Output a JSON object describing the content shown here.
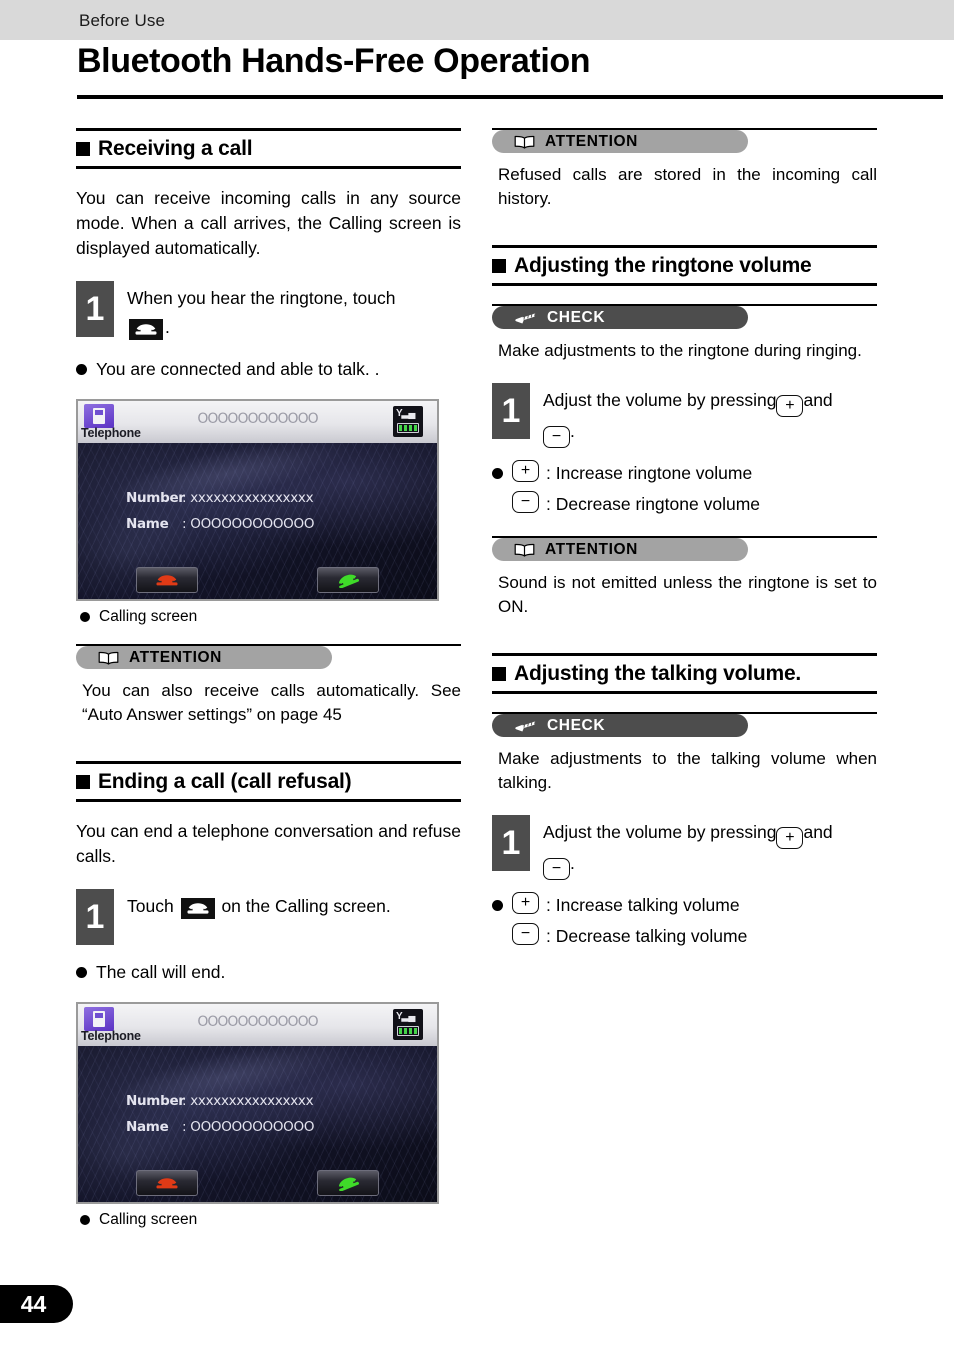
{
  "header": {
    "breadcrumb": "Before Use",
    "title": "Bluetooth Hands-Free Operation"
  },
  "footer": {
    "page_number": "44"
  },
  "icons": {
    "phone_handset": "phone-handset-icon",
    "book": "open-book-icon",
    "pencil": "pencil-icon",
    "plus_key": "plus-key-icon",
    "minus_key": "minus-key-icon"
  },
  "colors": {
    "header_band": "#d9d9d9",
    "step_badge": "#4d4d4d",
    "attention_pill": "#a3a3a3",
    "check_pill": "#4d4d4d",
    "page_pill": "#000000"
  },
  "keys": {
    "plus": "+",
    "minus": "−"
  },
  "left_column": {
    "section_receiving": {
      "heading": "Receiving a call",
      "intro": "You can receive incoming calls in any source mode. When a call arrives, the Calling screen is displayed automatically.",
      "step": {
        "number": "1",
        "text_before": "When you hear the ringtone, touch",
        "text_after": "."
      },
      "result_bullet": "You are connected and able to talk. .",
      "screen_caption": "Calling screen"
    },
    "attention_autoanswer": {
      "label": "ATTENTION",
      "body": "You can also receive calls automatically. See “Auto Answer settings” on page 45"
    },
    "section_ending": {
      "heading": "Ending a call (call refusal)",
      "intro": "You can end a telephone conversation and refuse calls.",
      "step": {
        "number": "1",
        "text_before": "Touch",
        "text_after": "on the Calling screen."
      },
      "result_bullet": "The call will end.",
      "screen_caption": "Calling screen"
    }
  },
  "right_column": {
    "attention_refused": {
      "label": "ATTENTION",
      "body": "Refused calls are stored in the incoming call history."
    },
    "section_ringtone": {
      "heading": "Adjusting the ringtone volume",
      "check": {
        "label": "CHECK",
        "body": "Make adjustments to the ringtone during ringing."
      },
      "step": {
        "number": "1",
        "text_before": "Adjust the volume by pressing",
        "text_middle": "and",
        "text_after": "."
      },
      "increase_label": ": Increase ringtone volume",
      "decrease_label": ": Decrease ringtone volume"
    },
    "attention_ringtone_on": {
      "label": "ATTENTION",
      "body": "Sound is not emitted unless the ringtone is set to ON."
    },
    "section_talking": {
      "heading": "Adjusting the talking volume.",
      "check": {
        "label": "CHECK",
        "body": "Make adjustments to the talking volume when talking."
      },
      "step": {
        "number": "1",
        "text_before": "Adjust the volume by pressing",
        "text_middle": "and",
        "text_after": "."
      },
      "increase_label": ": Increase talking volume",
      "decrease_label": ": Decrease talking volume"
    }
  },
  "telephone_screen": {
    "app_label": "Telephone",
    "title_text": "OOOOOOOOOOOO",
    "number_label": "Number",
    "number_value": ": xxxxxxxxxxxxxxxx",
    "name_label": "Name",
    "name_value": ": OOOOOOOOOOOO",
    "end_button": "end-call-button",
    "answer_button": "answer-call-button",
    "signal_icon": "signal-bars-icon",
    "battery_icon": "battery-icon"
  }
}
